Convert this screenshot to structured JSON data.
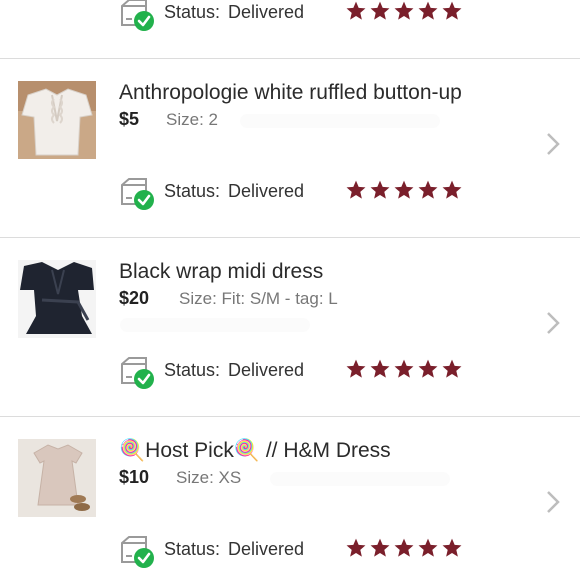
{
  "listings": [
    {
      "title": "",
      "price": "",
      "size_label": "",
      "size_value": "",
      "status_label": "Status:",
      "status_value": "Delivered",
      "rating": 5
    },
    {
      "title": "Anthropologie white ruffled button-up",
      "price": "$5",
      "size_label": "Size:",
      "size_value": "2",
      "status_label": "Status:",
      "status_value": "Delivered",
      "rating": 5
    },
    {
      "title": "Black wrap midi dress",
      "price": "$20",
      "size_label": "Size:",
      "size_value": "Fit: S/M - tag: L",
      "status_label": "Status:",
      "status_value": "Delivered",
      "rating": 5
    },
    {
      "title": "🍭Host Pick🍭 // H&M Dress",
      "price": "$10",
      "size_label": "Size:",
      "size_value": "XS",
      "status_label": "Status:",
      "status_value": "Delivered",
      "rating": 5
    }
  ],
  "colors": {
    "star": "#7a1f2b",
    "check": "#22b14c",
    "divider": "#dcdcdc"
  },
  "icons": {
    "status": "delivered-box-check-icon",
    "chevron": "chevron-right-icon",
    "star": "star-icon"
  }
}
